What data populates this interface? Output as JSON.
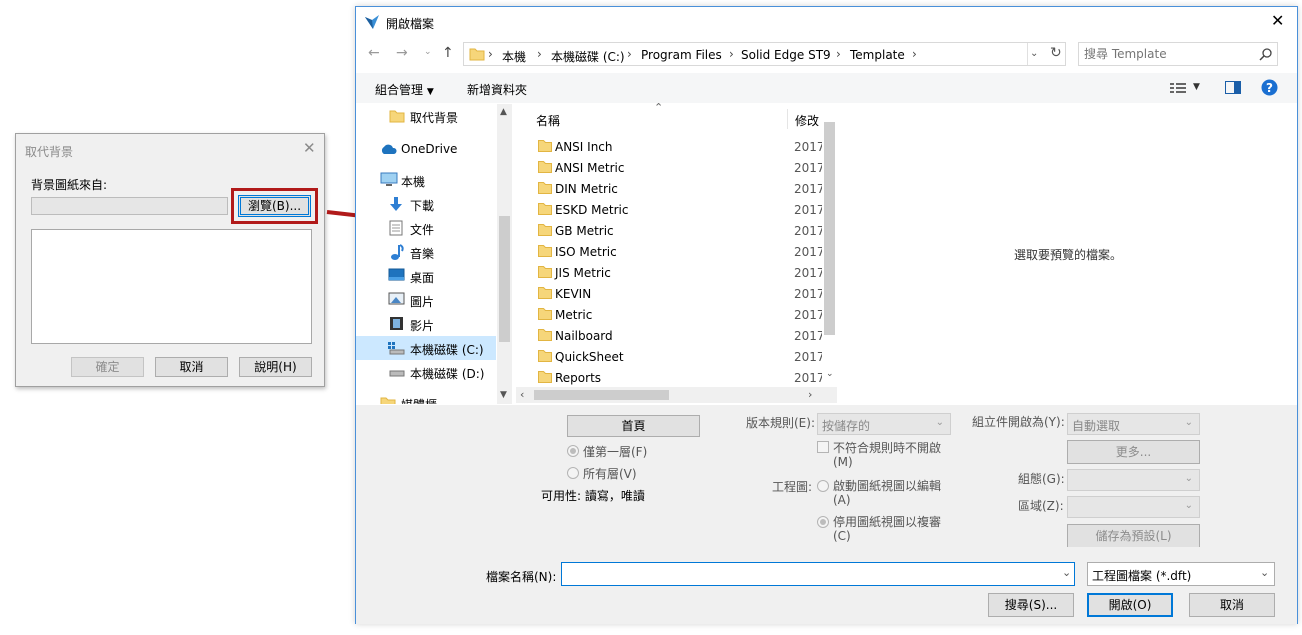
{
  "small_dialog": {
    "title": "取代背景",
    "label": "背景圖紙來自:",
    "browse_label": "瀏覽(B)...",
    "ok_label": "確定",
    "cancel_label": "取消",
    "help_label": "說明(H)"
  },
  "main_dialog": {
    "title": "開啟檔案",
    "breadcrumb": [
      "本機",
      "本機磁碟 (C:)",
      "Program Files",
      "Solid Edge ST9",
      "Template"
    ],
    "search_placeholder": "搜尋 Template",
    "toolbar": {
      "organize": "組合管理",
      "new_folder": "新增資料夾"
    },
    "nav_items": [
      {
        "label": "取代背景",
        "icon": "folder-icon"
      },
      {
        "label": "OneDrive",
        "icon": "cloud-icon"
      },
      {
        "label": "本機",
        "icon": "computer-icon"
      },
      {
        "label": "下載",
        "icon": "download-icon"
      },
      {
        "label": "文件",
        "icon": "document-icon"
      },
      {
        "label": "音樂",
        "icon": "music-icon"
      },
      {
        "label": "桌面",
        "icon": "desktop-icon"
      },
      {
        "label": "圖片",
        "icon": "picture-icon"
      },
      {
        "label": "影片",
        "icon": "video-icon"
      },
      {
        "label": "本機磁碟 (C:)",
        "icon": "drive-icon",
        "selected": true
      },
      {
        "label": "本機磁碟 (D:)",
        "icon": "drive-icon"
      },
      {
        "label": "媒體櫃",
        "icon": "library-icon"
      }
    ],
    "columns": {
      "name": "名稱",
      "modified": "修改"
    },
    "files": [
      {
        "name": "ANSI Inch",
        "date": "2017"
      },
      {
        "name": "ANSI Metric",
        "date": "2017"
      },
      {
        "name": "DIN Metric",
        "date": "2017"
      },
      {
        "name": "ESKD Metric",
        "date": "2017"
      },
      {
        "name": "GB Metric",
        "date": "2017"
      },
      {
        "name": "ISO Metric",
        "date": "2017"
      },
      {
        "name": "JIS Metric",
        "date": "2017"
      },
      {
        "name": "KEVIN",
        "date": "2017"
      },
      {
        "name": "Metric",
        "date": "2017"
      },
      {
        "name": "Nailboard",
        "date": "2017"
      },
      {
        "name": "QuickSheet",
        "date": "2017"
      },
      {
        "name": "Reports",
        "date": "2017"
      }
    ],
    "preview_message": "選取要預覽的檔案。",
    "options": {
      "first_page_button": "首頁",
      "first_layer": "僅第一層(F)",
      "all_layers": "所有層(V)",
      "availability": "可用性: 讀寫，唯讀",
      "version_rule_label": "版本規則(E):",
      "version_rule_value": "按儲存的",
      "no_open_checkbox": "不符合規則時不開啟",
      "no_open_key": "(M)",
      "drawing_label": "工程圖:",
      "enable_view": "啟動圖紙視圖以編輯",
      "enable_key": "(A)",
      "disable_view": "停用圖紙視圖以複審",
      "disable_key": "(C)",
      "assembly_open_label": "組立件開啟為(Y):",
      "assembly_open_value": "自動選取",
      "more_button": "更多...",
      "config_label": "組態(G):",
      "zone_label": "區域(Z):",
      "save_default_button": "儲存為預設(L)"
    },
    "filename_label": "檔案名稱(N):",
    "filename_value": "",
    "filetype_value": "工程圖檔案 (*.dft)",
    "search_button": "搜尋(S)...",
    "open_button": "開啟(O)",
    "cancel_button": "取消"
  }
}
